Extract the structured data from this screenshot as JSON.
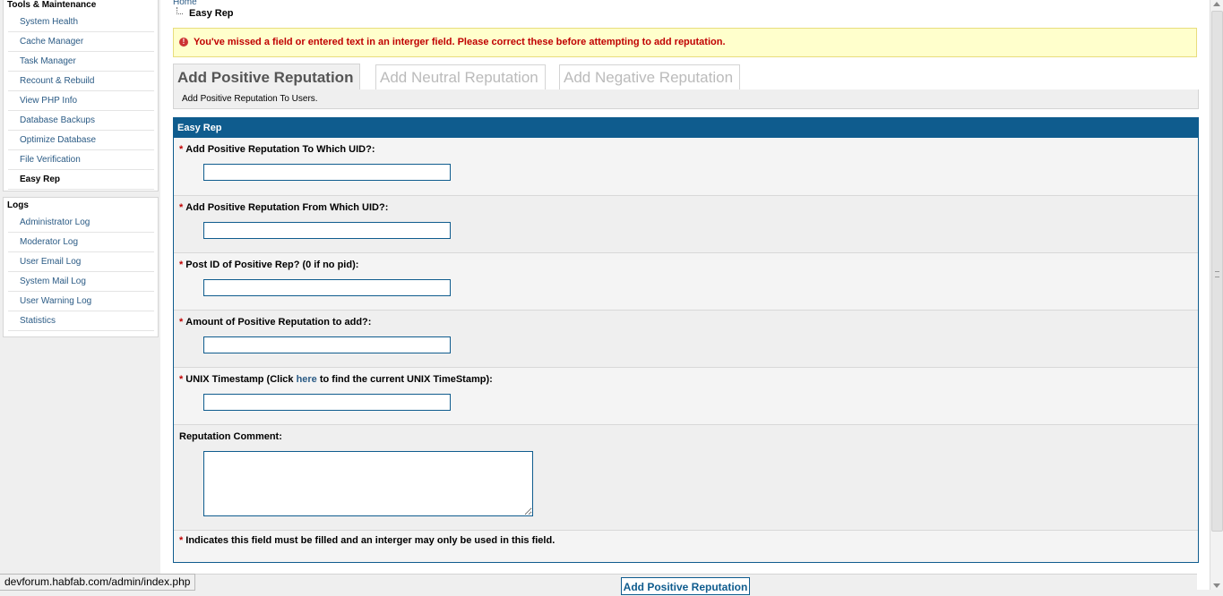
{
  "sidebar": {
    "tools_title": "Tools & Maintenance",
    "tools_items": [
      {
        "label": "System Health"
      },
      {
        "label": "Cache Manager"
      },
      {
        "label": "Task Manager"
      },
      {
        "label": "Recount & Rebuild"
      },
      {
        "label": "View PHP Info"
      },
      {
        "label": "Database Backups"
      },
      {
        "label": "Optimize Database"
      },
      {
        "label": "File Verification"
      },
      {
        "label": "Easy Rep"
      }
    ],
    "logs_title": "Logs",
    "logs_items": [
      {
        "label": "Administrator Log"
      },
      {
        "label": "Moderator Log"
      },
      {
        "label": "User Email Log"
      },
      {
        "label": "System Mail Log"
      },
      {
        "label": "User Warning Log"
      },
      {
        "label": "Statistics"
      }
    ]
  },
  "breadcrumb": {
    "home": "Home",
    "current": "Easy Rep"
  },
  "error": {
    "icon": "error-icon",
    "message": "You've missed a field or entered text in an interger field. Please correct these before attempting to add reputation."
  },
  "tabs": [
    {
      "label": "Add Positive Reputation",
      "active": true
    },
    {
      "label": "Add Neutral Reputation",
      "active": false
    },
    {
      "label": "Add Negative Reputation",
      "active": false
    }
  ],
  "tab_description": "Add Positive Reputation To Users.",
  "form": {
    "title": "Easy Rep",
    "required_marker": "*",
    "fields": [
      {
        "label": "Add Positive Reputation To Which UID?:",
        "value": ""
      },
      {
        "label": "Add Positive Reputation From Which UID?:",
        "value": ""
      },
      {
        "label": "Post ID of Positive Rep? (0 if no pid):",
        "value": ""
      },
      {
        "label": "Amount of Positive Reputation to add?:",
        "value": ""
      },
      {
        "label_before": "UNIX Timestamp (Click ",
        "link": "here",
        "label_after": " to find the current UNIX TimeStamp):",
        "value": ""
      }
    ],
    "comment_label": "Reputation Comment:",
    "comment_value": "",
    "footnote": "Indicates this field must be filled and an interger may only be used in this field.",
    "submit_label": "Add Positive Reputation"
  },
  "statusbar": {
    "url": "devforum.habfab.com/admin/index.php"
  },
  "colors": {
    "accent": "#0f5c8e",
    "error": "#c00000",
    "error_bg": "#ffffcc",
    "link": "#2b5b85"
  }
}
